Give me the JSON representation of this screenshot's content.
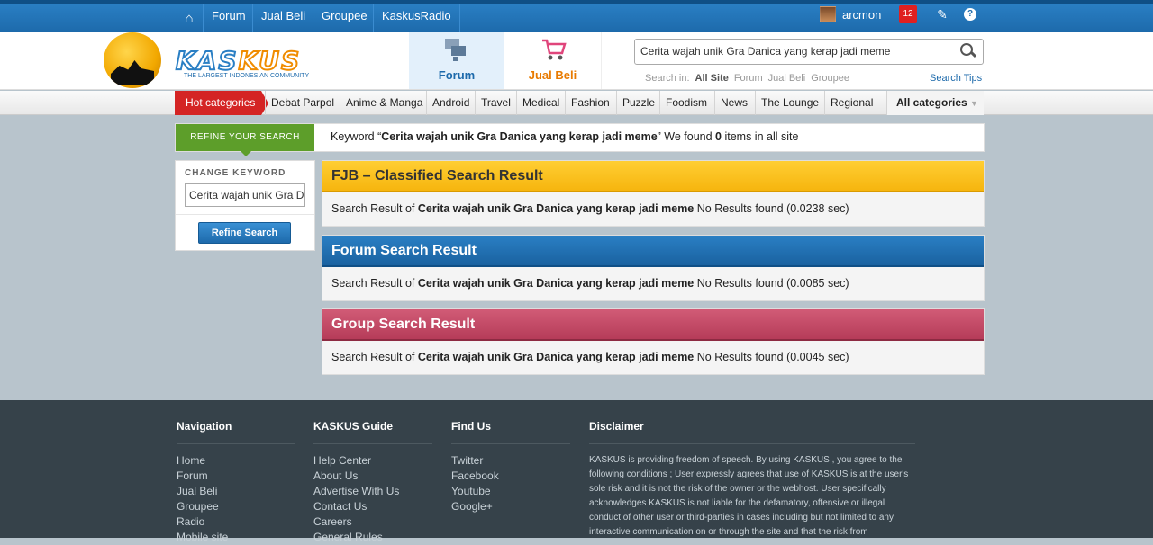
{
  "topbar": {
    "nav": [
      "Forum",
      "Jual Beli",
      "Groupee",
      "KaskusRadio"
    ],
    "username": "arcmon",
    "notifications": "12"
  },
  "header": {
    "logo_text_a": "KAS",
    "logo_text_b": "KUS",
    "logo_tagline": "THE LARGEST INDONESIAN COMMUNITY",
    "tab_forum": "Forum",
    "tab_jualbeli": "Jual Beli",
    "search_value": "Cerita wajah unik Gra Danica yang kerap jadi meme",
    "search_in_label": "Search in:",
    "search_in_options": [
      "All Site",
      "Forum",
      "Jual Beli",
      "Groupee"
    ],
    "search_tips": "Search Tips"
  },
  "categories": {
    "hot": "Hot categories",
    "items": [
      "Debat Parpol",
      "Anime & Manga",
      "Android",
      "Travel",
      "Medical",
      "Fashion",
      "Puzzle",
      "Foodism",
      "News",
      "The Lounge",
      "Regional"
    ],
    "all": "All categories"
  },
  "refine": {
    "tag": "REFINE YOUR SEARCH",
    "kw_prefix": "Keyword “",
    "kw_term": "Cerita wajah unik Gra Danica yang kerap jadi meme",
    "kw_mid": "” We found ",
    "kw_count": "0",
    "kw_suffix": " items in all site",
    "change_label": "CHANGE KEYWORD",
    "input_value": "Cerita wajah unik Gra Danica yang kerap jadi meme",
    "button": "Refine Search"
  },
  "results": {
    "prefix": "Search Result of ",
    "term": "Cerita wajah unik Gra Danica yang kerap jadi meme",
    "fjb": {
      "title": "FJB – Classified Search Result",
      "status": "  No Results found (0.0238 sec)"
    },
    "forum": {
      "title": "Forum Search Result",
      "status": " No Results found (0.0085 sec)"
    },
    "group": {
      "title": "Group Search Result",
      "status": " No Results found (0.0045 sec)"
    }
  },
  "footer": {
    "nav_title": "Navigation",
    "nav_links": [
      "Home",
      "Forum",
      "Jual Beli",
      "Groupee",
      "Radio",
      "Mobile site"
    ],
    "guide_title": "KASKUS Guide",
    "guide_links": [
      "Help Center",
      "About Us",
      "Advertise With Us",
      "Contact Us",
      "Careers",
      "General Rules"
    ],
    "find_title": "Find Us",
    "find_links": [
      "Twitter",
      "Facebook",
      "Youtube",
      "Google+"
    ],
    "disclaimer_title": "Disclaimer",
    "disclaimer_text": "KASKUS is providing freedom of speech. By using KASKUS , you agree to the following conditions ; User expressly agrees that use of KASKUS is at the user's sole risk and it is not the risk of the owner or the webhost. User specifically acknowledges KASKUS is not liable for the defamatory, offensive or illegal conduct of other user or third-parties in cases including but not limited to any interactive communication on or through the site and that the risk from"
  }
}
